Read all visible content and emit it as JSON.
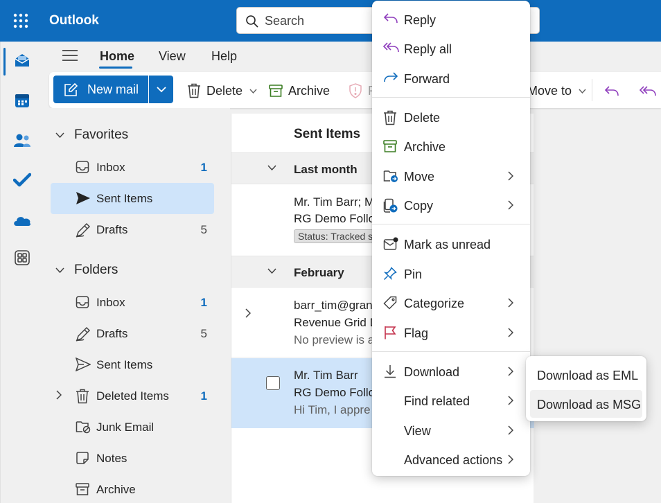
{
  "app": {
    "title": "Outlook"
  },
  "search": {
    "placeholder": "Search"
  },
  "nav_tabs": [
    "Home",
    "View",
    "Help"
  ],
  "ribbon": {
    "new_mail": "New mail",
    "delete": "Delete",
    "archive": "Archive",
    "report_partial": "R",
    "move_to": "Move to"
  },
  "favorites": {
    "header": "Favorites",
    "items": [
      {
        "label": "Inbox",
        "count": "1"
      },
      {
        "label": "Sent Items",
        "count": ""
      },
      {
        "label": "Drafts",
        "count": "5"
      }
    ]
  },
  "folders": {
    "header": "Folders",
    "items": [
      {
        "label": "Inbox",
        "count": "1"
      },
      {
        "label": "Drafts",
        "count": "5"
      },
      {
        "label": "Sent Items",
        "count": ""
      },
      {
        "label": "Deleted Items",
        "count": "1"
      },
      {
        "label": "Junk Email",
        "count": ""
      },
      {
        "label": "Notes",
        "count": ""
      },
      {
        "label": "Archive",
        "count": ""
      }
    ]
  },
  "mail_list": {
    "title": "Sent Items",
    "groups": [
      {
        "label": "Last month",
        "items": [
          {
            "to": "Mr. Tim Barr; M",
            "subject": "RG Demo Follo",
            "tag": "Status: Tracked s"
          }
        ]
      },
      {
        "label": "February",
        "items": [
          {
            "to": "barr_tim@gran",
            "subject": "Revenue Grid D",
            "preview": "No preview is a"
          },
          {
            "to": "Mr. Tim Barr",
            "subject": "RG Demo Follo",
            "preview": "Hi Tim, I appre"
          }
        ]
      }
    ]
  },
  "context_menu": {
    "items": [
      {
        "label": "Reply",
        "icon": "reply-icon"
      },
      {
        "label": "Reply all",
        "icon": "reply-all-icon"
      },
      {
        "label": "Forward",
        "icon": "forward-icon"
      },
      {
        "label": "Delete",
        "icon": "delete-icon"
      },
      {
        "label": "Archive",
        "icon": "archive-icon"
      },
      {
        "label": "Move",
        "icon": "move-icon"
      },
      {
        "label": "Copy",
        "icon": "copy-icon"
      },
      {
        "label": "Mark as unread",
        "icon": "mark-unread-icon"
      },
      {
        "label": "Pin",
        "icon": "pin-icon"
      },
      {
        "label": "Categorize",
        "icon": "tag-icon"
      },
      {
        "label": "Flag",
        "icon": "flag-icon"
      },
      {
        "label": "Download",
        "icon": "download-icon"
      },
      {
        "label": "Find related",
        "icon": ""
      },
      {
        "label": "View",
        "icon": ""
      },
      {
        "label": "Advanced actions",
        "icon": ""
      }
    ]
  },
  "download_submenu": {
    "items": [
      {
        "label": "Download as EML"
      },
      {
        "label": "Download as MSG"
      }
    ]
  },
  "colors": {
    "brand": "#0f6cbd",
    "selected": "#cfe4fa",
    "reply_all": "#8f3ebd",
    "archive": "#3a7d22",
    "flag": "#c4314b"
  }
}
